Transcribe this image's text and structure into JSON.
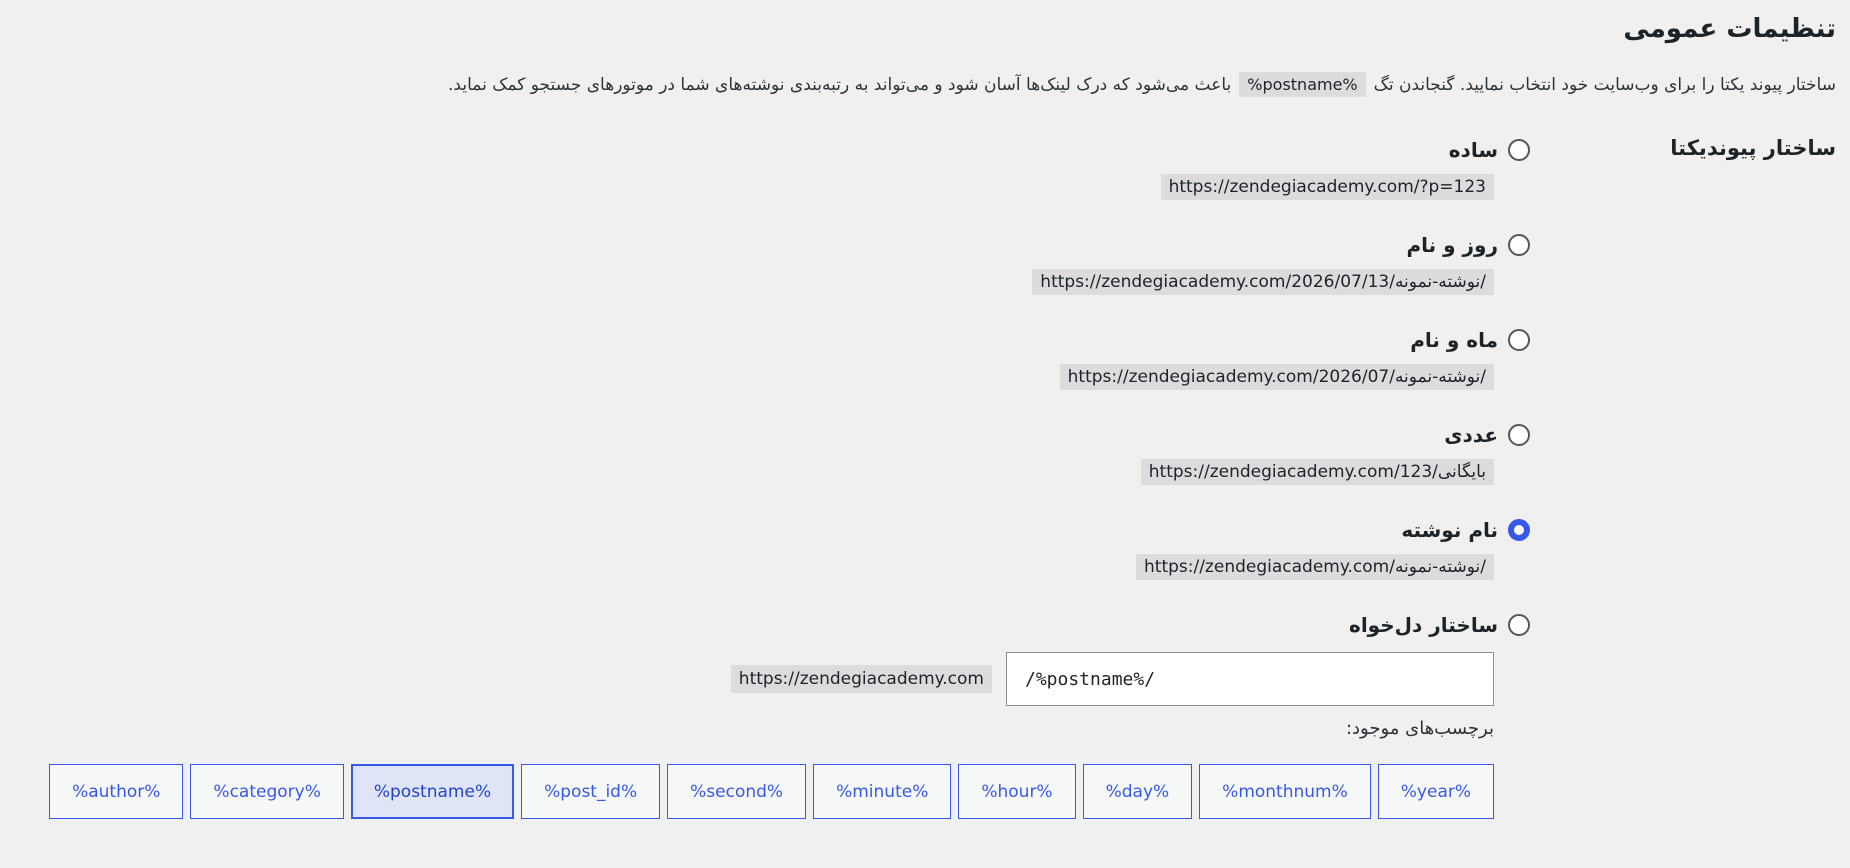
{
  "page": {
    "title": "تنظیمات عمومی",
    "intro_before": "ساختار پیوند یکتا را برای وب‌سایت خود انتخاب نمایید. گنجاندن تگ",
    "intro_tag": "%postname%",
    "intro_after": "باعث می‌شود که درک لینک‌ها آسان شود و می‌تواند به رتبه‌بندی نوشته‌های شما در موتورهای جستجو کمک نماید."
  },
  "permalinks": {
    "section_label": "ساختار پیوندیکتا",
    "options": [
      {
        "label": "ساده",
        "sample": "https://zendegiacademy.com/?p=123",
        "checked": false
      },
      {
        "label": "روز و نام",
        "sample": "https://zendegiacademy.com/2026/07/13/نوشته-نمونه/",
        "checked": false
      },
      {
        "label": "ماه و نام",
        "sample": "https://zendegiacademy.com/2026/07/نوشته-نمونه/",
        "checked": false
      },
      {
        "label": "عددی",
        "sample": "https://zendegiacademy.com/بایگانی/123",
        "checked": false
      },
      {
        "label": "نام نوشته",
        "sample": "https://zendegiacademy.com/نوشته-نمونه/",
        "checked": true
      },
      {
        "label": "ساختار دل‌خواه",
        "checked": false
      }
    ],
    "custom": {
      "base_url": "https://zendegiacademy.com",
      "value": "/%postname%/"
    },
    "tags_label": "برچسب‌های موجود:",
    "tags": [
      "%year%",
      "%monthnum%",
      "%day%",
      "%hour%",
      "%minute%",
      "%second%",
      "%post_id%",
      "%postname%",
      "%category%",
      "%author%"
    ],
    "active_tag": "%postname%"
  },
  "colors": {
    "accent": "#3858e9",
    "background": "#f0f0f1",
    "code_bg": "#dcdcde"
  }
}
